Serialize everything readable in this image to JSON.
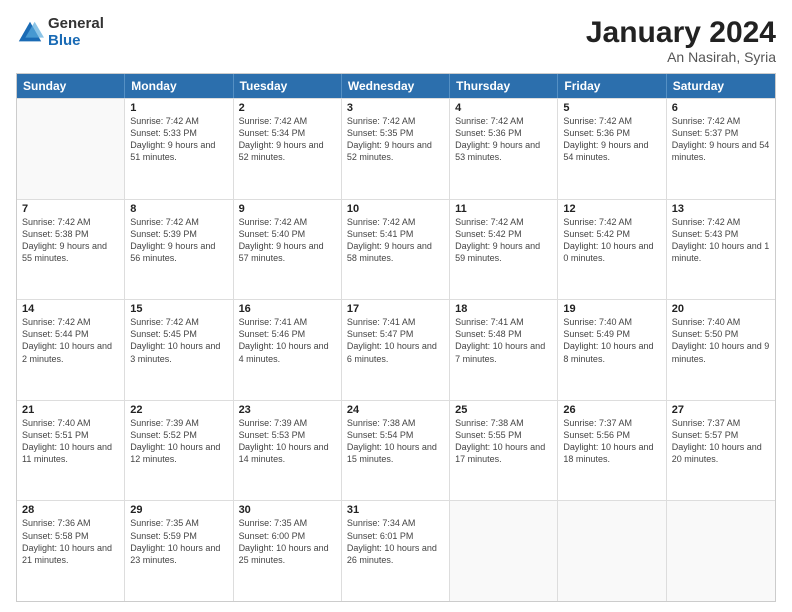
{
  "logo": {
    "general": "General",
    "blue": "Blue"
  },
  "title": {
    "month": "January 2024",
    "location": "An Nasirah, Syria"
  },
  "header_days": [
    "Sunday",
    "Monday",
    "Tuesday",
    "Wednesday",
    "Thursday",
    "Friday",
    "Saturday"
  ],
  "weeks": [
    [
      {
        "day": "",
        "sunrise": "",
        "sunset": "",
        "daylight": ""
      },
      {
        "day": "1",
        "sunrise": "Sunrise: 7:42 AM",
        "sunset": "Sunset: 5:33 PM",
        "daylight": "Daylight: 9 hours and 51 minutes."
      },
      {
        "day": "2",
        "sunrise": "Sunrise: 7:42 AM",
        "sunset": "Sunset: 5:34 PM",
        "daylight": "Daylight: 9 hours and 52 minutes."
      },
      {
        "day": "3",
        "sunrise": "Sunrise: 7:42 AM",
        "sunset": "Sunset: 5:35 PM",
        "daylight": "Daylight: 9 hours and 52 minutes."
      },
      {
        "day": "4",
        "sunrise": "Sunrise: 7:42 AM",
        "sunset": "Sunset: 5:36 PM",
        "daylight": "Daylight: 9 hours and 53 minutes."
      },
      {
        "day": "5",
        "sunrise": "Sunrise: 7:42 AM",
        "sunset": "Sunset: 5:36 PM",
        "daylight": "Daylight: 9 hours and 54 minutes."
      },
      {
        "day": "6",
        "sunrise": "Sunrise: 7:42 AM",
        "sunset": "Sunset: 5:37 PM",
        "daylight": "Daylight: 9 hours and 54 minutes."
      }
    ],
    [
      {
        "day": "7",
        "sunrise": "Sunrise: 7:42 AM",
        "sunset": "Sunset: 5:38 PM",
        "daylight": "Daylight: 9 hours and 55 minutes."
      },
      {
        "day": "8",
        "sunrise": "Sunrise: 7:42 AM",
        "sunset": "Sunset: 5:39 PM",
        "daylight": "Daylight: 9 hours and 56 minutes."
      },
      {
        "day": "9",
        "sunrise": "Sunrise: 7:42 AM",
        "sunset": "Sunset: 5:40 PM",
        "daylight": "Daylight: 9 hours and 57 minutes."
      },
      {
        "day": "10",
        "sunrise": "Sunrise: 7:42 AM",
        "sunset": "Sunset: 5:41 PM",
        "daylight": "Daylight: 9 hours and 58 minutes."
      },
      {
        "day": "11",
        "sunrise": "Sunrise: 7:42 AM",
        "sunset": "Sunset: 5:42 PM",
        "daylight": "Daylight: 9 hours and 59 minutes."
      },
      {
        "day": "12",
        "sunrise": "Sunrise: 7:42 AM",
        "sunset": "Sunset: 5:42 PM",
        "daylight": "Daylight: 10 hours and 0 minutes."
      },
      {
        "day": "13",
        "sunrise": "Sunrise: 7:42 AM",
        "sunset": "Sunset: 5:43 PM",
        "daylight": "Daylight: 10 hours and 1 minute."
      }
    ],
    [
      {
        "day": "14",
        "sunrise": "Sunrise: 7:42 AM",
        "sunset": "Sunset: 5:44 PM",
        "daylight": "Daylight: 10 hours and 2 minutes."
      },
      {
        "day": "15",
        "sunrise": "Sunrise: 7:42 AM",
        "sunset": "Sunset: 5:45 PM",
        "daylight": "Daylight: 10 hours and 3 minutes."
      },
      {
        "day": "16",
        "sunrise": "Sunrise: 7:41 AM",
        "sunset": "Sunset: 5:46 PM",
        "daylight": "Daylight: 10 hours and 4 minutes."
      },
      {
        "day": "17",
        "sunrise": "Sunrise: 7:41 AM",
        "sunset": "Sunset: 5:47 PM",
        "daylight": "Daylight: 10 hours and 6 minutes."
      },
      {
        "day": "18",
        "sunrise": "Sunrise: 7:41 AM",
        "sunset": "Sunset: 5:48 PM",
        "daylight": "Daylight: 10 hours and 7 minutes."
      },
      {
        "day": "19",
        "sunrise": "Sunrise: 7:40 AM",
        "sunset": "Sunset: 5:49 PM",
        "daylight": "Daylight: 10 hours and 8 minutes."
      },
      {
        "day": "20",
        "sunrise": "Sunrise: 7:40 AM",
        "sunset": "Sunset: 5:50 PM",
        "daylight": "Daylight: 10 hours and 9 minutes."
      }
    ],
    [
      {
        "day": "21",
        "sunrise": "Sunrise: 7:40 AM",
        "sunset": "Sunset: 5:51 PM",
        "daylight": "Daylight: 10 hours and 11 minutes."
      },
      {
        "day": "22",
        "sunrise": "Sunrise: 7:39 AM",
        "sunset": "Sunset: 5:52 PM",
        "daylight": "Daylight: 10 hours and 12 minutes."
      },
      {
        "day": "23",
        "sunrise": "Sunrise: 7:39 AM",
        "sunset": "Sunset: 5:53 PM",
        "daylight": "Daylight: 10 hours and 14 minutes."
      },
      {
        "day": "24",
        "sunrise": "Sunrise: 7:38 AM",
        "sunset": "Sunset: 5:54 PM",
        "daylight": "Daylight: 10 hours and 15 minutes."
      },
      {
        "day": "25",
        "sunrise": "Sunrise: 7:38 AM",
        "sunset": "Sunset: 5:55 PM",
        "daylight": "Daylight: 10 hours and 17 minutes."
      },
      {
        "day": "26",
        "sunrise": "Sunrise: 7:37 AM",
        "sunset": "Sunset: 5:56 PM",
        "daylight": "Daylight: 10 hours and 18 minutes."
      },
      {
        "day": "27",
        "sunrise": "Sunrise: 7:37 AM",
        "sunset": "Sunset: 5:57 PM",
        "daylight": "Daylight: 10 hours and 20 minutes."
      }
    ],
    [
      {
        "day": "28",
        "sunrise": "Sunrise: 7:36 AM",
        "sunset": "Sunset: 5:58 PM",
        "daylight": "Daylight: 10 hours and 21 minutes."
      },
      {
        "day": "29",
        "sunrise": "Sunrise: 7:35 AM",
        "sunset": "Sunset: 5:59 PM",
        "daylight": "Daylight: 10 hours and 23 minutes."
      },
      {
        "day": "30",
        "sunrise": "Sunrise: 7:35 AM",
        "sunset": "Sunset: 6:00 PM",
        "daylight": "Daylight: 10 hours and 25 minutes."
      },
      {
        "day": "31",
        "sunrise": "Sunrise: 7:34 AM",
        "sunset": "Sunset: 6:01 PM",
        "daylight": "Daylight: 10 hours and 26 minutes."
      },
      {
        "day": "",
        "sunrise": "",
        "sunset": "",
        "daylight": ""
      },
      {
        "day": "",
        "sunrise": "",
        "sunset": "",
        "daylight": ""
      },
      {
        "day": "",
        "sunrise": "",
        "sunset": "",
        "daylight": ""
      }
    ]
  ]
}
